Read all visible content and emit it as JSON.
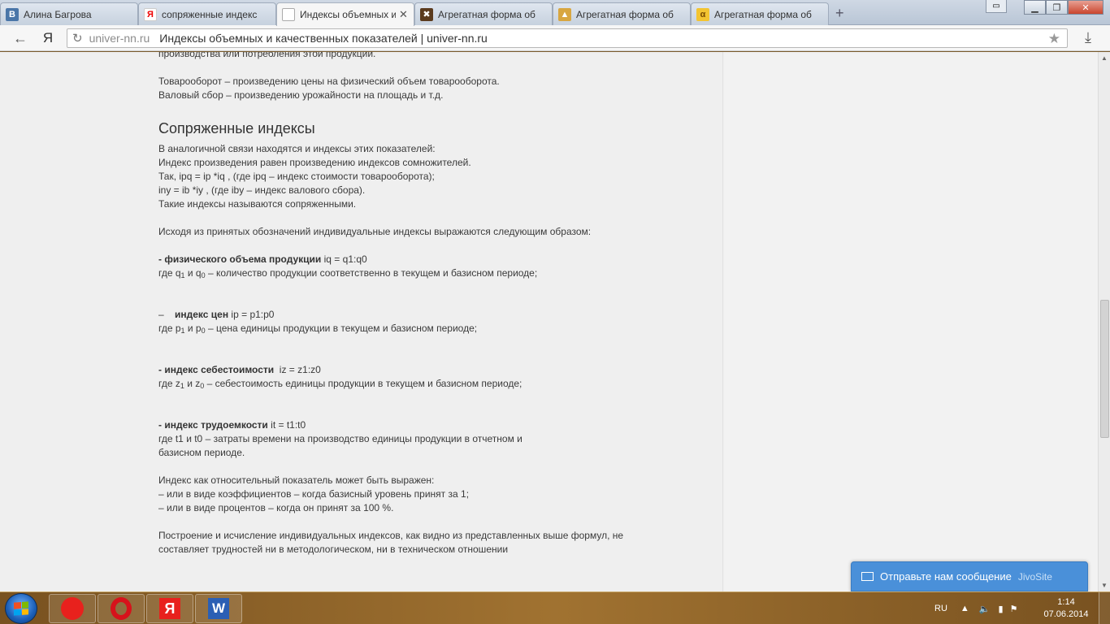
{
  "browser": {
    "tabs": [
      {
        "label": "Алина Багрова",
        "icon": "vk-icon",
        "active": false
      },
      {
        "label": "сопряженные индекс",
        "icon": "yandex-icon",
        "active": false
      },
      {
        "label": "Индексы объемных и",
        "icon": "page-icon",
        "active": true
      },
      {
        "label": "Агрегатная форма об",
        "icon": "joomla-icon",
        "active": false
      },
      {
        "label": "Агрегатная форма об",
        "icon": "hat-icon",
        "active": false
      },
      {
        "label": "Агрегатная форма об",
        "icon": "alpha-icon",
        "active": false
      }
    ],
    "yandex_label": "Я",
    "address_host": "univer-nn.ru",
    "address_title": "Индексы объемных и качественных показателей | univer-nn.ru"
  },
  "article": {
    "p_top": "производства или потребления этой продукции.",
    "p_turnover": "Товарооборот – произведению цены на физический объем товарооборота.",
    "p_gross": "Валовый сбор – произведению урожайности на площадь и т.д.",
    "heading": "Сопряженные индексы",
    "conj_1": "В аналогичной связи находятся и индексы этих показателей:",
    "conj_2": "Индекс произведения равен произведению индексов сомножителей.",
    "conj_3": "Так, ipq = ip *iq , (где ipq – индекс стоимости товарооборота);",
    "conj_4": "iny = ib *iy , (где iby – индекс валового сбора).",
    "conj_5": "Такие индексы называются сопряженными.",
    "intro": "Исходя из принятых обозначений индивидуальные индексы выражаются следующим образом:",
    "phys_bold": "- физического объема продукции",
    "phys_formula": " iq = q1:q0",
    "phys_desc_a": "где q",
    "phys_sub1": "1",
    "phys_desc_b": " и q",
    "phys_sub0": "0",
    "phys_desc_c": " – количество продукции соответственно в текущем и базисном периоде;",
    "price_dash": "–    ",
    "price_bold": "индекс цен",
    "price_formula": " ip = p1:p0",
    "price_desc_a": "где p",
    "price_sub1": "1",
    "price_desc_b": " и p",
    "price_sub0": "0",
    "price_desc_c": " – цена единицы продукции в текущем и базисном периоде;",
    "cost_bold": "- индекс себестоимости",
    "cost_formula": "  iz = z1:z0",
    "cost_desc_a": "где z",
    "cost_sub1": "1",
    "cost_desc_b": " и z",
    "cost_sub0": "0",
    "cost_desc_c": " – себестоимость единицы продукции в текущем и базисном периоде;",
    "labor_bold": "- индекс трудоемкости",
    "labor_formula": " it = t1:t0",
    "labor_desc_1": "где t1 и t0 – затраты времени на производство единицы продукции в отчетном и",
    "labor_desc_2": "базисном периоде.",
    "rel_1": "Индекс как относительный показатель может быть выражен:",
    "rel_2": "– или в виде коэффициентов – когда базисный уровень принят за 1;",
    "rel_3": "– или в виде процентов – когда он принят за 100 %.",
    "final_1": "Построение и исчисление индивидуальных индексов, как видно из представленных выше формул, не",
    "final_2": "составляет трудностей ни в методологическом, ни в техническом отношении"
  },
  "jivo": {
    "label": "Отправьте нам сообщение",
    "brand": "JivoSite"
  },
  "taskbar": {
    "lang": "RU",
    "time": "1:14",
    "date": "07.06.2014",
    "apps": [
      "yandex-browser-icon",
      "opera-icon",
      "yandex-icon",
      "word-icon"
    ],
    "app_letters": {
      "yandex": "Я",
      "word": "W"
    }
  },
  "colors": {
    "jivo": "#4a90d9",
    "accent": "#1b5fb7"
  }
}
